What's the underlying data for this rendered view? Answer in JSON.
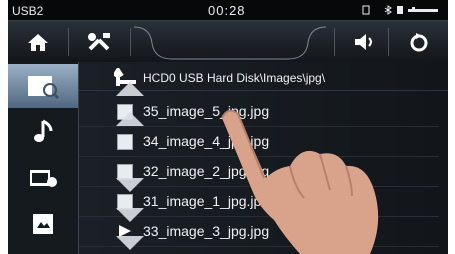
{
  "status": {
    "source": "USB2",
    "time": "00:28"
  },
  "toolbar": {
    "home_icon": "home-icon",
    "settings_icon": "tools-icon",
    "volume_icon": "speaker-icon",
    "refresh_icon": "refresh-icon"
  },
  "sidebar": {
    "items": [
      {
        "icon": "folder-search-icon",
        "active": true
      },
      {
        "icon": "music-note-icon",
        "active": false
      },
      {
        "icon": "video-icon",
        "active": false
      },
      {
        "icon": "image-icon",
        "active": false
      }
    ]
  },
  "browser": {
    "path": "HCD0 USB Hard Disk\\Images\\jpg\\",
    "files": [
      {
        "name": "35_image_5_jpg.jpg"
      },
      {
        "name": "34_image_4_jpg.jpg"
      },
      {
        "name": "32_image_2_jpg.jpg"
      },
      {
        "name": "31_image_1_jpg.jpg"
      },
      {
        "name": "33_image_3_jpg.jpg"
      }
    ]
  },
  "colors": {
    "accent": "#4f6880",
    "background": "#101418"
  }
}
